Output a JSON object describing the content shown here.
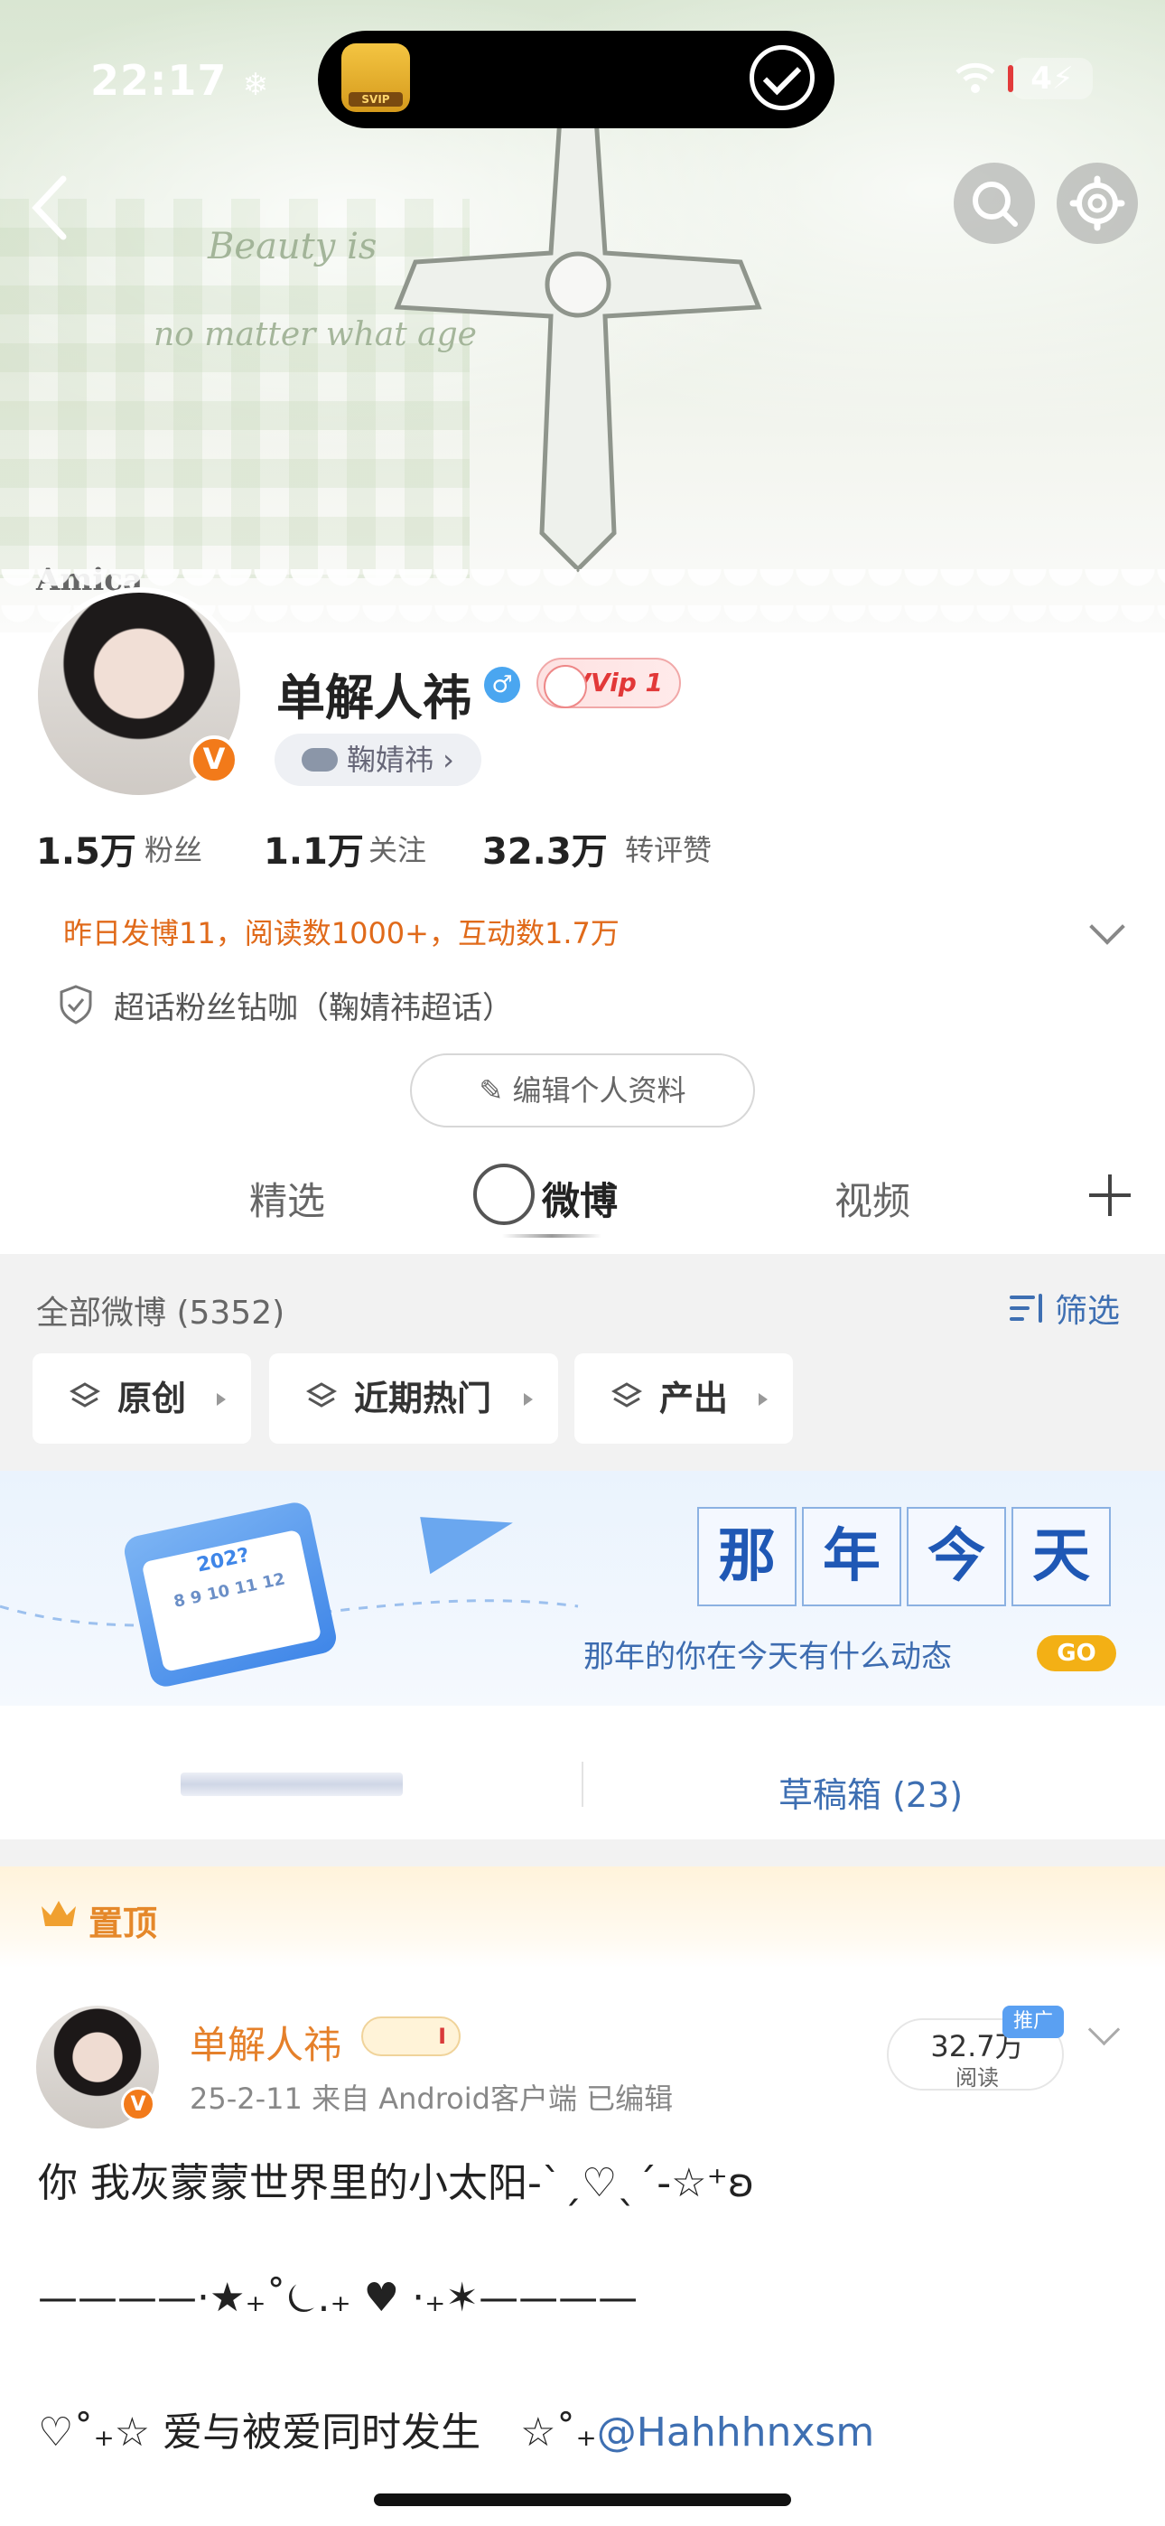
{
  "status_bar": {
    "time": "22:17",
    "time_extra": "❄",
    "battery": "4"
  },
  "banner": {
    "script_line1": "Beauty is",
    "script_line2": "no matter what age",
    "amica": "Amica"
  },
  "profile": {
    "name": "单解人祎",
    "gender_icon": "♂",
    "vip_label": "VVip 1",
    "verified_badge": "V",
    "chaohua_label": "鞠婧祎 ›",
    "stats": [
      {
        "value": "1.5万",
        "label": "粉丝"
      },
      {
        "value": "1.1万",
        "label": "关注"
      },
      {
        "value": "32.3万",
        "label": "转评赞"
      }
    ],
    "activity": "昨日发博11，阅读数1000+，互动数1.7万",
    "fan_badge": "超话粉丝钻咖（鞠婧祎超话）",
    "edit_button": "编辑个人资料"
  },
  "tabs": [
    {
      "label": "精选"
    },
    {
      "label": "微博",
      "active": true
    },
    {
      "label": "视频"
    }
  ],
  "filter": {
    "all_label": "全部微博 (5352)",
    "filter_button": "筛选",
    "chips": [
      "原创",
      "近期热门",
      "产出"
    ]
  },
  "promo": {
    "title_chars": [
      "那",
      "年",
      "今",
      "天"
    ],
    "subtitle": "那年的你在今天有什么动态",
    "go": "GO",
    "calendar_year": "202?",
    "calendar_days": "8 9 10 11 12"
  },
  "draft": {
    "label": "草稿箱 (23)"
  },
  "pinned": {
    "label": "置顶",
    "author": "单解人祎",
    "author_badge": "I",
    "meta": "25-2-11  来自 Android客户端  已编辑",
    "read_count": "32.7万",
    "read_label": "阅读",
    "promo_tag": "推广",
    "line1": "你 我灰蒙蒙世界里的小太阳-ˋˏ♡ˎˊ-☆⁺ʚ",
    "line2": "————·★₊˚⏾.₊ ♥ ·₊✶————",
    "line3_text": "♡˚₊☆ 爱与被爱同时发生　☆˚₊",
    "line3_mention": "@Hahhhnxsm"
  },
  "colors": {
    "accent_orange": "#e5802a",
    "link_blue": "#3e6fb2",
    "activity_orange": "#e06a1a"
  }
}
